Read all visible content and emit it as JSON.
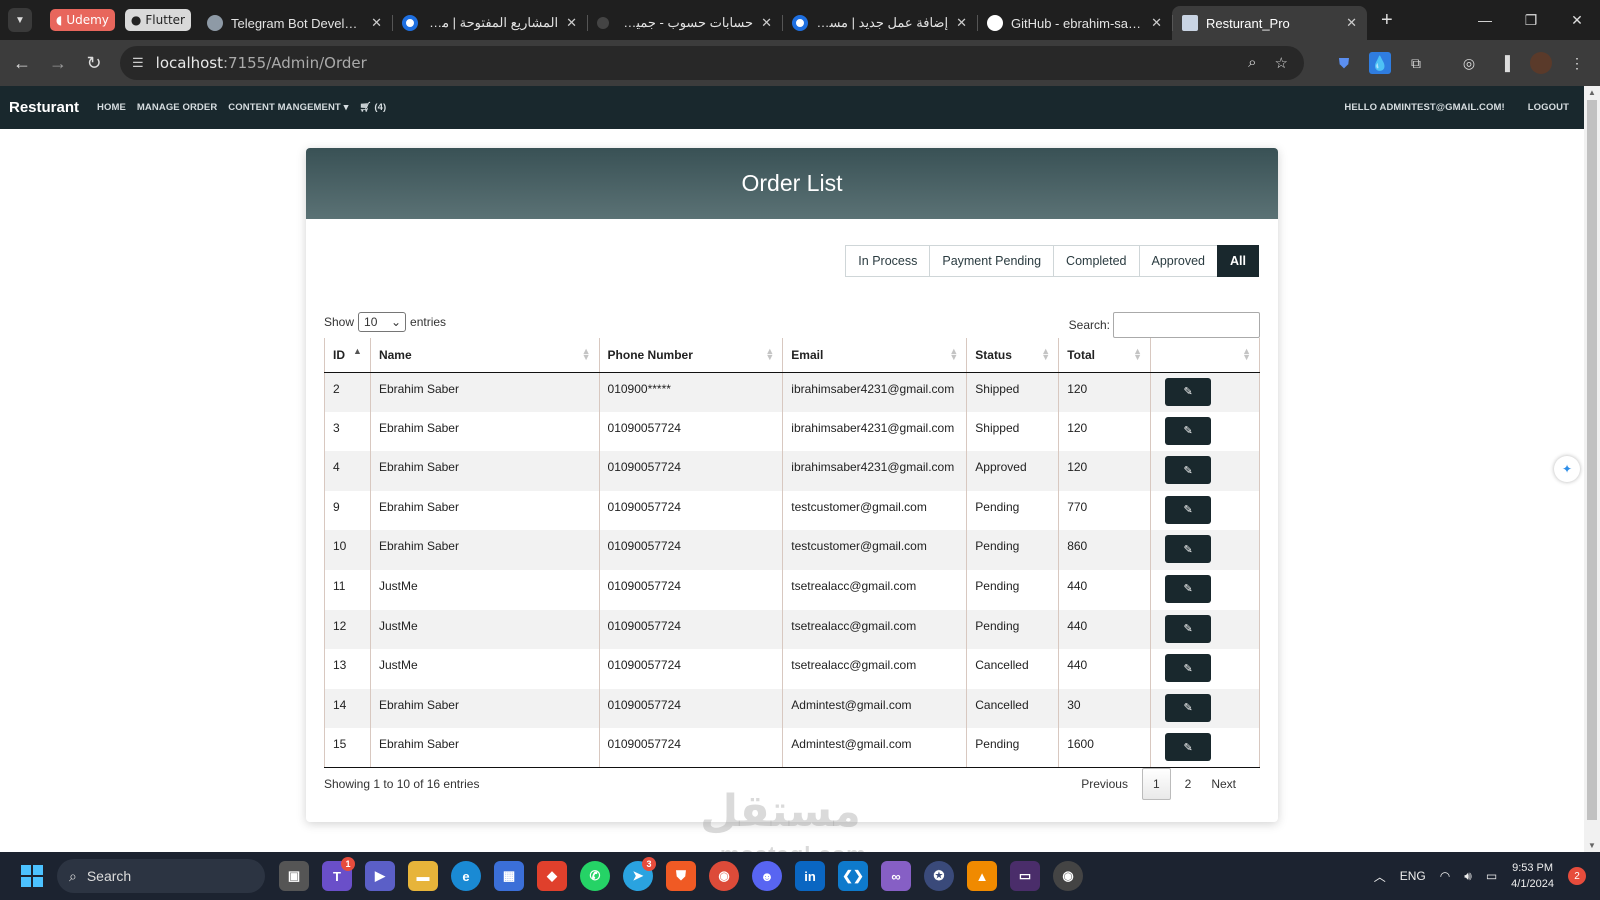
{
  "browser": {
    "pinned_tabs": [
      "Udemy",
      "Flutter"
    ],
    "tabs": [
      {
        "title": "Telegram Bot Developm",
        "favicon": "telegram-icon"
      },
      {
        "title": "المشاريع المفتوحة | مستقل",
        "favicon": "mostaql-icon"
      },
      {
        "title": "حسابات حسوب - جميع ما",
        "favicon": "hsoub-icon"
      },
      {
        "title": "إضافة عمل جديد | مستقل",
        "favicon": "mostaql-icon"
      },
      {
        "title": "GitHub - ebrahim-saber",
        "favicon": "github-icon"
      },
      {
        "title": "Resturant_Pro",
        "favicon": "page-icon",
        "active": true
      }
    ],
    "url_host": "localhost",
    "url_path": ":7155/Admin/Order"
  },
  "navbar": {
    "brand": "Resturant",
    "links": [
      "HOME",
      "MANAGE ORDER",
      "CONTENT MANGEMENT"
    ],
    "cart_count": "(4)",
    "greeting": "HELLO ADMINTEST@GMAIL.COM!",
    "logout": "LOGOUT"
  },
  "card": {
    "title": "Order List",
    "filters": [
      "In Process",
      "Payment Pending",
      "Completed",
      "Approved",
      "All"
    ],
    "active_filter": "All"
  },
  "table_controls": {
    "show_label": "Show",
    "entries_value": "10",
    "entries_label": "entries",
    "search_label": "Search:"
  },
  "table": {
    "columns": [
      "ID",
      "Name",
      "Phone Number",
      "Email",
      "Status",
      "Total",
      ""
    ],
    "rows": [
      [
        "2",
        "Ebrahim Saber",
        "010900*****",
        "ibrahimsaber4231@gmail.com",
        "Shipped",
        "120"
      ],
      [
        "3",
        "Ebrahim Saber",
        "01090057724",
        "ibrahimsaber4231@gmail.com",
        "Shipped",
        "120"
      ],
      [
        "4",
        "Ebrahim Saber",
        "01090057724",
        "ibrahimsaber4231@gmail.com",
        "Approved",
        "120"
      ],
      [
        "9",
        "Ebrahim Saber",
        "01090057724",
        "testcustomer@gmail.com",
        "Pending",
        "770"
      ],
      [
        "10",
        "Ebrahim Saber",
        "01090057724",
        "testcustomer@gmail.com",
        "Pending",
        "860"
      ],
      [
        "11",
        "JustMe",
        "01090057724",
        "tsetrealacc@gmail.com",
        "Pending",
        "440"
      ],
      [
        "12",
        "JustMe",
        "01090057724",
        "tsetrealacc@gmail.com",
        "Pending",
        "440"
      ],
      [
        "13",
        "JustMe",
        "01090057724",
        "tsetrealacc@gmail.com",
        "Cancelled",
        "440"
      ],
      [
        "14",
        "Ebrahim Saber",
        "01090057724",
        "Admintest@gmail.com",
        "Cancelled",
        "30"
      ],
      [
        "15",
        "Ebrahim Saber",
        "01090057724",
        "Admintest@gmail.com",
        "Pending",
        "1600"
      ]
    ]
  },
  "pagination": {
    "info": "Showing 1 to 10 of 16 entries",
    "previous": "Previous",
    "pages": [
      "1",
      "2"
    ],
    "current": "1",
    "next": "Next"
  },
  "watermark": {
    "arabic": "مستقل",
    "latin": "mostaql.com"
  },
  "taskbar": {
    "search_label": "Search",
    "language": "ENG",
    "time": "9:53 PM",
    "date": "4/1/2024",
    "notifications": "2"
  },
  "colors": {
    "navbar": "#19282d",
    "header_gradient_top": "#395155",
    "accent_button": "#19282d"
  }
}
